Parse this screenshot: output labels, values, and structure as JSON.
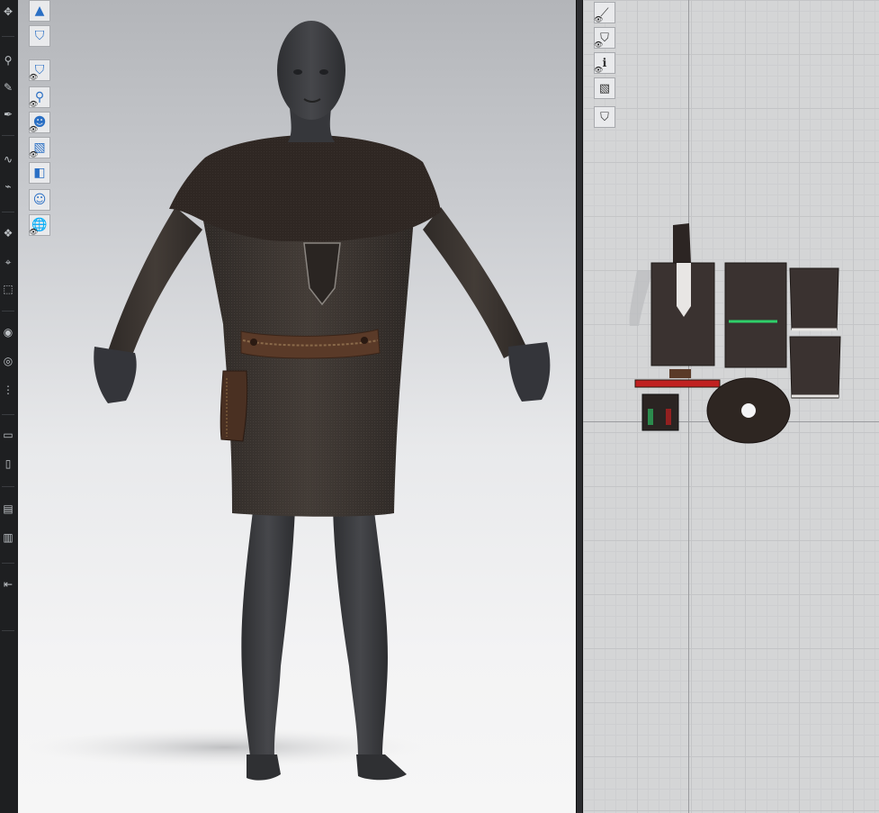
{
  "left_toolbar": {
    "tools": [
      {
        "name": "select-move-icon",
        "glyph": "✥"
      },
      {
        "name": "pin-icon",
        "glyph": "⚲"
      },
      {
        "name": "brush-icon",
        "glyph": "✎"
      },
      {
        "name": "pen-icon",
        "glyph": "✒"
      },
      {
        "name": "sewing-icon",
        "glyph": "∿"
      },
      {
        "name": "edit-sewing-icon",
        "glyph": "⌁"
      },
      {
        "name": "fold-icon",
        "glyph": "❖"
      },
      {
        "name": "measure-icon",
        "glyph": "⌖"
      },
      {
        "name": "arrange-icon",
        "glyph": "⬚"
      },
      {
        "name": "button-icon",
        "glyph": "◉"
      },
      {
        "name": "buttonhole-icon",
        "glyph": "◎"
      },
      {
        "name": "zipper-icon",
        "glyph": "⋮"
      },
      {
        "name": "tape-icon",
        "glyph": "▭"
      },
      {
        "name": "trim-icon",
        "glyph": "▯"
      },
      {
        "name": "puckering-icon",
        "glyph": "▤"
      },
      {
        "name": "elastic-icon",
        "glyph": "▥"
      },
      {
        "name": "collapse-arrow-icon",
        "glyph": "⇤"
      }
    ]
  },
  "viewport3d": {
    "tools": [
      {
        "name": "simulation-mode-icon",
        "glyph": "▲",
        "eye": false
      },
      {
        "name": "garment-display-icon",
        "glyph": "⛉",
        "eye": false
      },
      {
        "name": "show-garment-icon",
        "glyph": "⛉",
        "eye": true
      },
      {
        "name": "show-pins-icon",
        "glyph": "⚲",
        "eye": true
      },
      {
        "name": "show-avatar-icon",
        "glyph": "☻",
        "eye": true
      },
      {
        "name": "show-texture-icon",
        "glyph": "▧",
        "eye": true
      },
      {
        "name": "show-trims-icon",
        "glyph": "◧",
        "eye": false
      },
      {
        "name": "avatar-display-icon",
        "glyph": "☺",
        "eye": false
      },
      {
        "name": "show-environment-icon",
        "glyph": "🌐",
        "eye": true
      }
    ]
  },
  "viewport2d": {
    "tools": [
      {
        "name": "show-base-line-icon",
        "glyph": "⟋",
        "eye": true
      },
      {
        "name": "show-pattern-icon",
        "glyph": "⛉",
        "eye": true
      },
      {
        "name": "show-info-icon",
        "glyph": "ℹ",
        "eye": true
      },
      {
        "name": "texture-display-icon",
        "glyph": "▧",
        "eye": false
      },
      {
        "name": "lock-pattern-icon",
        "glyph": "⛉",
        "eye": false
      }
    ]
  },
  "colors": {
    "avatar": "#3f4043",
    "cloth": "#3a3430",
    "cape": "#2e2622",
    "belt": "#5a3a28",
    "accent_blue": "#2a6fc4",
    "seam_green": "#2fd06a",
    "seam_red": "#c02020"
  }
}
